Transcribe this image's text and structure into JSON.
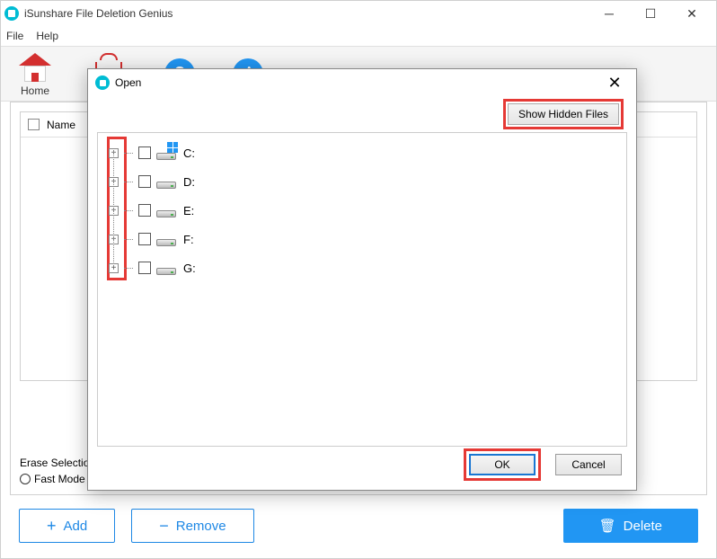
{
  "app": {
    "title": "iSunshare File Deletion Genius"
  },
  "menu": {
    "file": "File",
    "help": "Help"
  },
  "toolbar": {
    "home": "Home"
  },
  "list": {
    "name_header": "Name"
  },
  "erase": {
    "label": "Erase Selectio",
    "fast_mode": "Fast Mode"
  },
  "buttons": {
    "add": "Add",
    "remove": "Remove",
    "delete": "Delete"
  },
  "dialog": {
    "title": "Open",
    "show_hidden": "Show Hidden Files",
    "ok": "OK",
    "cancel": "Cancel",
    "drives": [
      {
        "label": "C:",
        "system": true
      },
      {
        "label": "D:",
        "system": false
      },
      {
        "label": "E:",
        "system": false
      },
      {
        "label": "F:",
        "system": false
      },
      {
        "label": "G:",
        "system": false
      }
    ]
  }
}
